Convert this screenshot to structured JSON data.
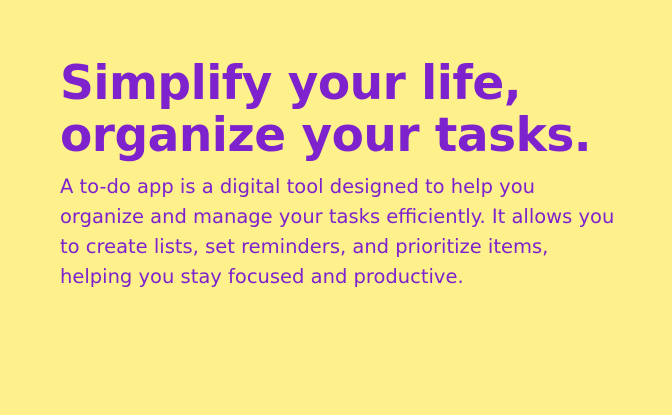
{
  "hero": {
    "headline_line1": "Simplify your life,",
    "headline_line2": "organize your tasks.",
    "description": "A to-do app is a digital tool designed to help you organize and manage your tasks efficiently. It allows you to create lists, set reminders, and prioritize items, helping you stay focused and productive."
  },
  "colors": {
    "background": "#FEF08A",
    "text": "#7E22CE"
  }
}
